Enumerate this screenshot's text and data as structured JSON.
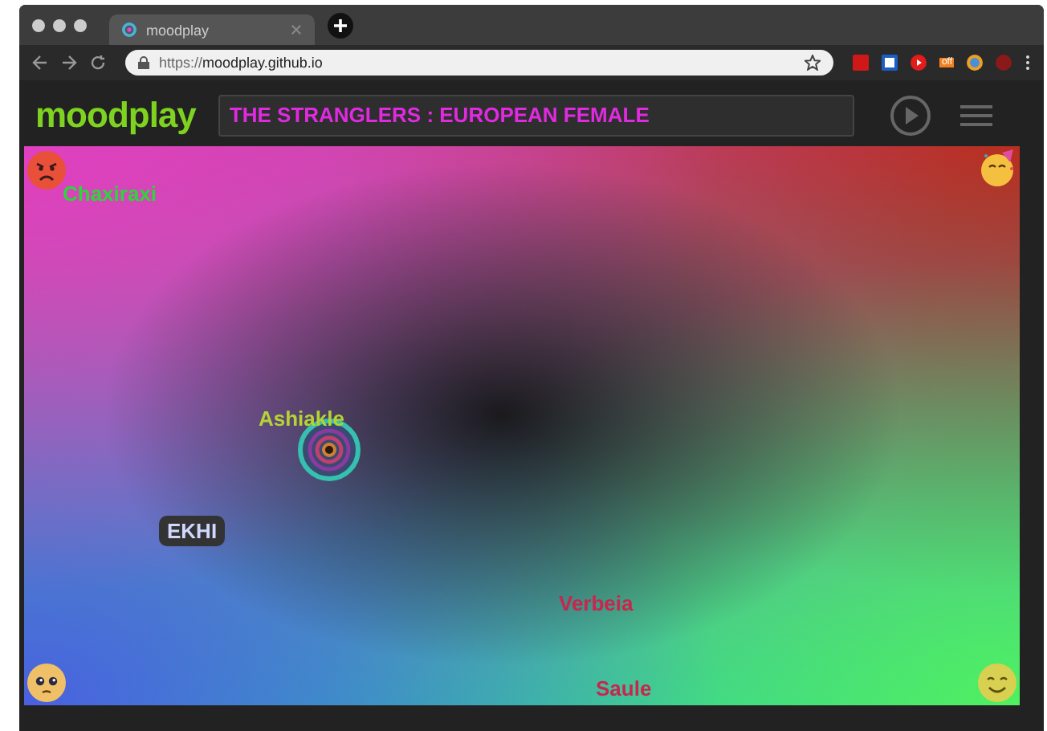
{
  "browser": {
    "tab_title": "moodplay",
    "url_prefix": "https://",
    "url_host": "moodplay.github.io",
    "extension_badge": "off"
  },
  "header": {
    "logo": "moodplay",
    "now_playing": "THE STRANGLERS : EUROPEAN FEMALE"
  },
  "map": {
    "labels": [
      {
        "text": "Chaxiraxi",
        "kind": "label",
        "color": "#2bd63a"
      },
      {
        "text": "Ashiakle",
        "kind": "label",
        "color": "#b5d334"
      },
      {
        "text": "EKHI",
        "kind": "badge"
      },
      {
        "text": "Verbeia",
        "kind": "label",
        "color": "#c8264e"
      },
      {
        "text": "Saule",
        "kind": "label",
        "color": "#c8264e"
      }
    ]
  }
}
